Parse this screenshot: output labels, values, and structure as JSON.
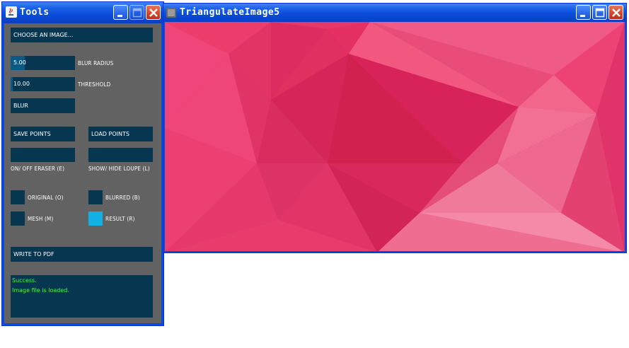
{
  "tools_window": {
    "title": "Tools",
    "choose_image_label": "CHOOSE AN IMAGE...",
    "blur_radius": {
      "value": "5.00",
      "label": "BLUR RADIUS",
      "level_fraction": 0.22
    },
    "threshold": {
      "value": "10.00",
      "label": "THRESHOLD",
      "level_fraction": 0.03
    },
    "blur_button_label": "BLUR",
    "save_points_label": "SAVE POINTS",
    "load_points_label": "LOAD POINTS",
    "eraser_label": "ON/ OFF ERASER (E)",
    "loupe_label": "SHOW/ HIDE LOUPE (L)",
    "views": {
      "original": {
        "label": "ORIGINAL (O)",
        "checked": false
      },
      "blurred": {
        "label": "BLURRED (B)",
        "checked": false
      },
      "mesh": {
        "label": "MESH (M)",
        "checked": false
      },
      "result": {
        "label": "RESULT (R)",
        "checked": true
      }
    },
    "write_pdf_label": "WRITE TO PDF",
    "log_lines": [
      "Success.",
      "Image file is loaded."
    ]
  },
  "image_window": {
    "title": "TriangulateImage5"
  },
  "colors": {
    "panel_bg": "#626262",
    "control_bg": "#073650",
    "checked": "#13b0e6",
    "log_text": "#3cff3c",
    "titlebar": "#0a4bd8"
  }
}
